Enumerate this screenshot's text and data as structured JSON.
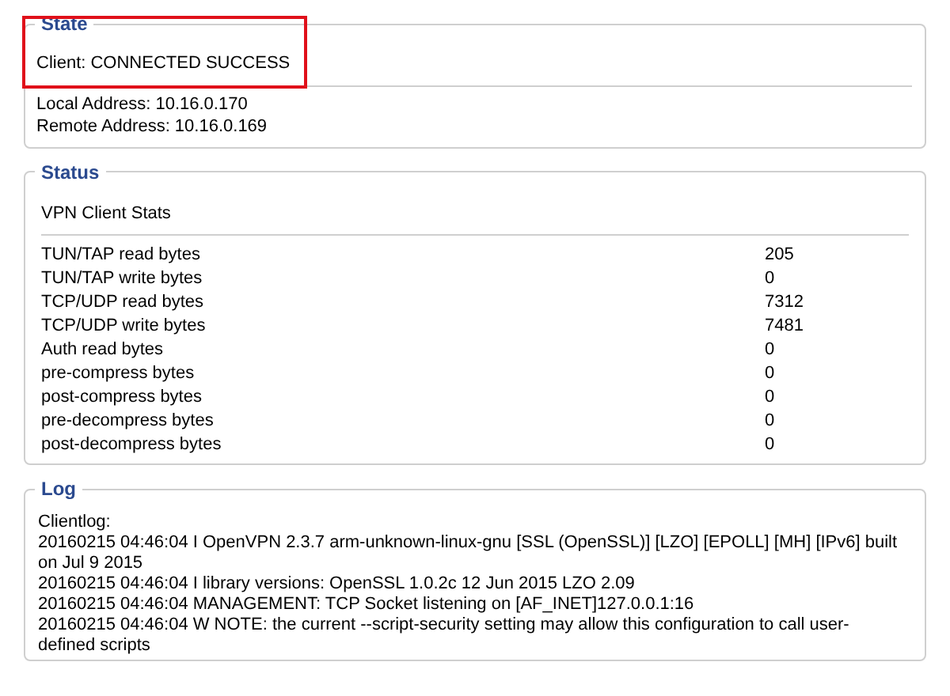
{
  "state": {
    "title": "State",
    "client": "Client: CONNECTED SUCCESS",
    "highlighted": true,
    "addresses": [
      "Local Address: 10.16.0.170",
      "Remote Address: 10.16.0.169"
    ]
  },
  "status": {
    "title": "Status",
    "heading": "VPN Client Stats",
    "rows": [
      {
        "label": "TUN/TAP read bytes",
        "value": "205"
      },
      {
        "label": "TUN/TAP write bytes",
        "value": "0"
      },
      {
        "label": "TCP/UDP read bytes",
        "value": "7312"
      },
      {
        "label": "TCP/UDP write bytes",
        "value": "7481"
      },
      {
        "label": "Auth read bytes",
        "value": "0"
      },
      {
        "label": "pre-compress bytes",
        "value": "0"
      },
      {
        "label": "post-compress bytes",
        "value": "0"
      },
      {
        "label": "pre-decompress bytes",
        "value": "0"
      },
      {
        "label": "post-decompress bytes",
        "value": "0"
      }
    ]
  },
  "log": {
    "title": "Log",
    "heading": "Clientlog:",
    "lines": [
      "20160215 04:46:04 I OpenVPN 2.3.7 arm-unknown-linux-gnu [SSL (OpenSSL)] [LZO] [EPOLL] [MH] [IPv6] built on Jul 9 2015",
      "20160215 04:46:04 I library versions: OpenSSL 1.0.2c 12 Jun 2015 LZO 2.09",
      "20160215 04:46:04 MANAGEMENT: TCP Socket listening on [AF_INET]127.0.0.1:16",
      "20160215 04:46:04 W NOTE: the current --script-security setting may allow this configuration to call user-defined scripts"
    ]
  }
}
